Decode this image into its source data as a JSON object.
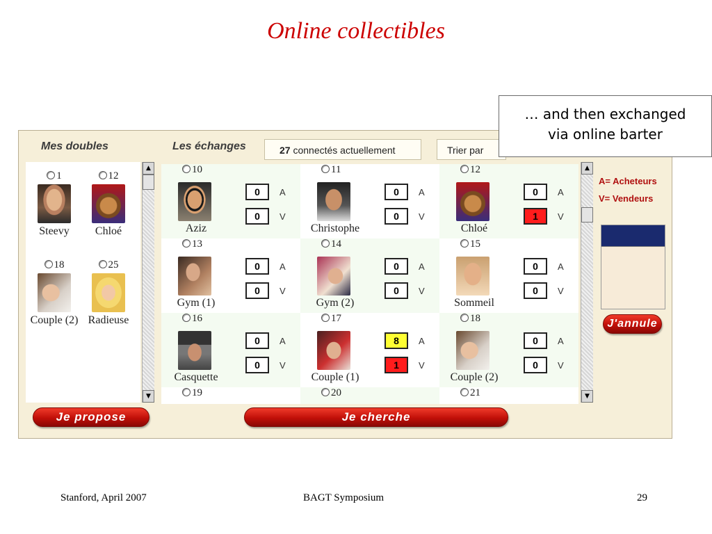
{
  "slide": {
    "title": "Online collectibles",
    "footer_left": "Stanford, April 2007",
    "footer_center": "BAGT Symposium",
    "footer_right": "29"
  },
  "callout": {
    "line1": "… and then exchanged",
    "line2": "via online barter"
  },
  "app": {
    "header_doubles": "Mes doubles",
    "header_echanges": "Les échanges",
    "connected_count": "27",
    "connected_text": " connectés actuellement",
    "sort_label": "Trier par",
    "legend_a": "A= Acheteurs",
    "legend_v": "V= Vendeurs",
    "button_propose": "Je propose",
    "button_cherche": "Je cherche",
    "button_annule": "J'annule",
    "counter_labels": {
      "a": "A",
      "v": "V"
    },
    "colors": {
      "yellow": "#ffff33",
      "red": "#ff1c1c",
      "brand_red": "#c00f08"
    },
    "doubles": [
      {
        "num": "1",
        "name": "Steevy"
      },
      {
        "num": "12",
        "name": "Chloé"
      },
      {
        "num": "18",
        "name": "Couple (2)"
      },
      {
        "num": "25",
        "name": "Radieuse"
      }
    ],
    "grid": [
      {
        "num": "10",
        "name": "Aziz",
        "a": "0",
        "v": "0"
      },
      {
        "num": "11",
        "name": "Christophe",
        "a": "0",
        "v": "0"
      },
      {
        "num": "12",
        "name": "Chloé",
        "a": "0",
        "v": "1"
      },
      {
        "num": "13",
        "name": "Gym (1)",
        "a": "0",
        "v": "0"
      },
      {
        "num": "14",
        "name": "Gym (2)",
        "a": "0",
        "v": "0"
      },
      {
        "num": "15",
        "name": "Sommeil",
        "a": "0",
        "v": "0"
      },
      {
        "num": "16",
        "name": "Casquette",
        "a": "0",
        "v": "0"
      },
      {
        "num": "17",
        "name": "Couple (1)",
        "a": "8",
        "v": "1"
      },
      {
        "num": "18",
        "name": "Couple (2)",
        "a": "0",
        "v": "0"
      },
      {
        "num": "19"
      },
      {
        "num": "20"
      },
      {
        "num": "21"
      }
    ]
  }
}
